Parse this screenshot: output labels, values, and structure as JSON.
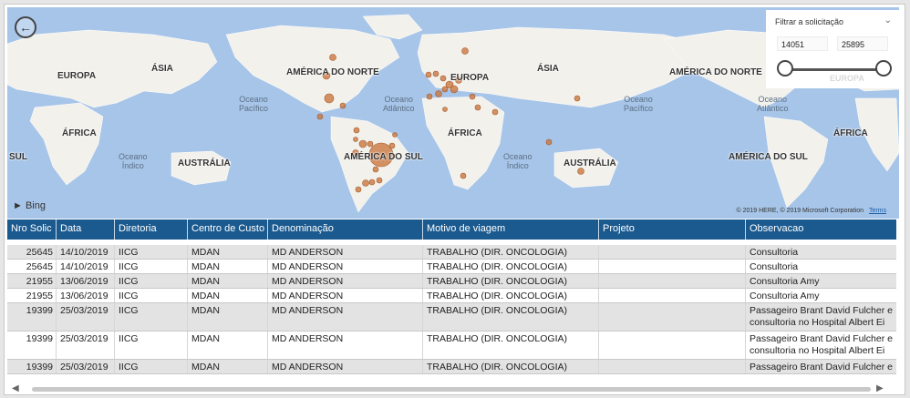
{
  "map": {
    "back_icon": "arrow-left-icon",
    "continents": [
      {
        "label": "EUROPA"
      },
      {
        "label": "ÁSIA"
      },
      {
        "label": "ÁFRICA"
      },
      {
        "label": "AUSTRÁLIA"
      },
      {
        "label": "AMÉRICA DO NORTE"
      },
      {
        "label": "EUROPA"
      },
      {
        "label": "ÁSIA"
      },
      {
        "label": "AMÉRICA DO NORTE"
      },
      {
        "label": "ÁFRICA"
      },
      {
        "label": "AMÉRICA DO SUL"
      },
      {
        "label": "AUSTRÁLIA"
      },
      {
        "label": "AMÉRICA DO SUL"
      },
      {
        "label": "ÁFRICA"
      },
      {
        "label": "SUL"
      }
    ],
    "oceans": [
      {
        "label": "Oceano\nPacífico"
      },
      {
        "label": "Oceano\nAtlântico"
      },
      {
        "label": "Oceano\nÍndico"
      },
      {
        "label": "Oceano\nPacífico"
      },
      {
        "label": "Oceano\nAtlântico"
      },
      {
        "label": "Oceano\nÍndico"
      }
    ],
    "bing_label": "Bing",
    "copyright": "© 2019 HERE, © 2019 Microsoft Corporation",
    "terms": "Terms",
    "bubble_color": "#c8743c"
  },
  "slicer": {
    "title": "Filtrar a solicitação",
    "min": "14051",
    "max": "25895",
    "faded_label": "EUROPA"
  },
  "table": {
    "header_color": "#1b5a8f",
    "columns": [
      "Nro Solic",
      "Data",
      "Diretoria",
      "Centro de Custo",
      "Denominação",
      "Motivo de viagem",
      "Projeto",
      "Observacao"
    ],
    "rows": [
      {
        "nro": "25645",
        "data": "14/10/2019",
        "diretoria": "IICG",
        "cc": "MDAN",
        "den": "MD ANDERSON",
        "motivo": "TRABALHO (DIR. ONCOLOGIA)",
        "projeto": "",
        "obs": "Consultoria"
      },
      {
        "nro": "25645",
        "data": "14/10/2019",
        "diretoria": "IICG",
        "cc": "MDAN",
        "den": "MD ANDERSON",
        "motivo": "TRABALHO (DIR. ONCOLOGIA)",
        "projeto": "",
        "obs": "Consultoria"
      },
      {
        "nro": "21955",
        "data": "13/06/2019",
        "diretoria": "IICG",
        "cc": "MDAN",
        "den": "MD ANDERSON",
        "motivo": "TRABALHO (DIR. ONCOLOGIA)",
        "projeto": "",
        "obs": "Consultoria Amy"
      },
      {
        "nro": "21955",
        "data": "13/06/2019",
        "diretoria": "IICG",
        "cc": "MDAN",
        "den": "MD ANDERSON",
        "motivo": "TRABALHO (DIR. ONCOLOGIA)",
        "projeto": "",
        "obs": "Consultoria Amy"
      },
      {
        "nro": "19399",
        "data": "25/03/2019",
        "diretoria": "IICG",
        "cc": "MDAN",
        "den": "MD ANDERSON",
        "motivo": "TRABALHO (DIR. ONCOLOGIA)",
        "projeto": "",
        "obs": "Passageiro Brant David Fulcher e consultoria no Hospital Albert Ei"
      },
      {
        "nro": "19399",
        "data": "25/03/2019",
        "diretoria": "IICG",
        "cc": "MDAN",
        "den": "MD ANDERSON",
        "motivo": "TRABALHO (DIR. ONCOLOGIA)",
        "projeto": "",
        "obs": "Passageiro Brant David Fulcher e consultoria no Hospital Albert Ei"
      },
      {
        "nro": "19399",
        "data": "25/03/2019",
        "diretoria": "IICG",
        "cc": "MDAN",
        "den": "MD ANDERSON",
        "motivo": "TRABALHO (DIR. ONCOLOGIA)",
        "projeto": "",
        "obs": "Passageiro Brant David Fulcher e"
      }
    ]
  }
}
